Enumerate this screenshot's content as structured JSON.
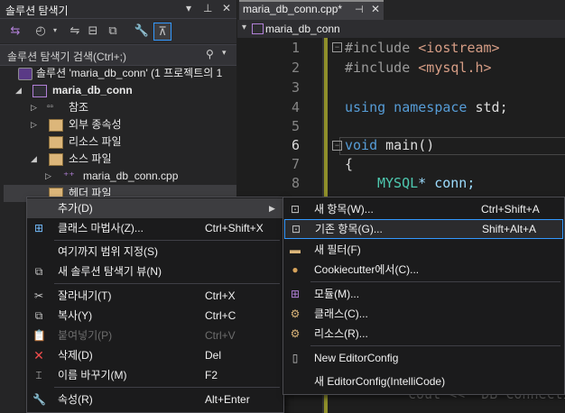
{
  "solution_explorer": {
    "title": "솔루션 탐색기",
    "search_placeholder": "솔루션 탐색기 검색(Ctrl+;)",
    "tree": [
      {
        "label": "솔루션 'maria_db_conn' (1 프로젝트의 1"
      },
      {
        "label": "maria_db_conn"
      },
      {
        "label": "참조"
      },
      {
        "label": "외부 종속성"
      },
      {
        "label": "리소스 파일"
      },
      {
        "label": "소스 파일"
      },
      {
        "label": "maria_db_conn.cpp"
      },
      {
        "label": "헤더 파일"
      }
    ]
  },
  "editor": {
    "tab_label": "maria_db_conn.cpp*",
    "nav_scope": "maria_db_conn",
    "line_numbers": [
      "1",
      "2",
      "3",
      "4",
      "5",
      "6",
      "7",
      "8"
    ],
    "lines": {
      "l1_a": "#include ",
      "l1_b": "<iostream>",
      "l2_a": "#include ",
      "l2_b": "<mysql.h>",
      "l4_a": "using namespace ",
      "l4_b": "std;",
      "l6_a": "void ",
      "l6_b": "main()",
      "l7": "{",
      "l8_a": "MYSQL",
      "l8_b": "* conn;",
      "partial": "cout << \"DB Connecti"
    }
  },
  "context_menu": {
    "items": [
      {
        "label": "추가(D)",
        "shortcut": ""
      },
      {
        "label": "클래스 마법사(Z)...",
        "shortcut": "Ctrl+Shift+X"
      },
      {
        "label": "여기까지 범위 지정(S)",
        "shortcut": ""
      },
      {
        "label": "새 솔루션 탐색기 뷰(N)",
        "shortcut": ""
      },
      {
        "label": "잘라내기(T)",
        "shortcut": "Ctrl+X"
      },
      {
        "label": "복사(Y)",
        "shortcut": "Ctrl+C"
      },
      {
        "label": "붙여넣기(P)",
        "shortcut": "Ctrl+V"
      },
      {
        "label": "삭제(D)",
        "shortcut": "Del"
      },
      {
        "label": "이름 바꾸기(M)",
        "shortcut": "F2"
      },
      {
        "label": "속성(R)",
        "shortcut": "Alt+Enter"
      }
    ]
  },
  "submenu": {
    "items": [
      {
        "label": "새 항목(W)...",
        "shortcut": "Ctrl+Shift+A"
      },
      {
        "label": "기존 항목(G)...",
        "shortcut": "Shift+Alt+A"
      },
      {
        "label": "새 필터(F)",
        "shortcut": ""
      },
      {
        "label": "Cookiecutter에서(C)...",
        "shortcut": ""
      },
      {
        "label": "모듈(M)...",
        "shortcut": ""
      },
      {
        "label": "클래스(C)...",
        "shortcut": ""
      },
      {
        "label": "리소스(R)...",
        "shortcut": ""
      },
      {
        "label": "New EditorConfig",
        "shortcut": ""
      },
      {
        "label": "새 EditorConfig(IntelliCode)",
        "shortcut": ""
      }
    ]
  },
  "colors": {
    "accent": "#3399ff",
    "keyword": "#569cd6",
    "string": "#d69d85",
    "type": "#4ec9b0"
  }
}
